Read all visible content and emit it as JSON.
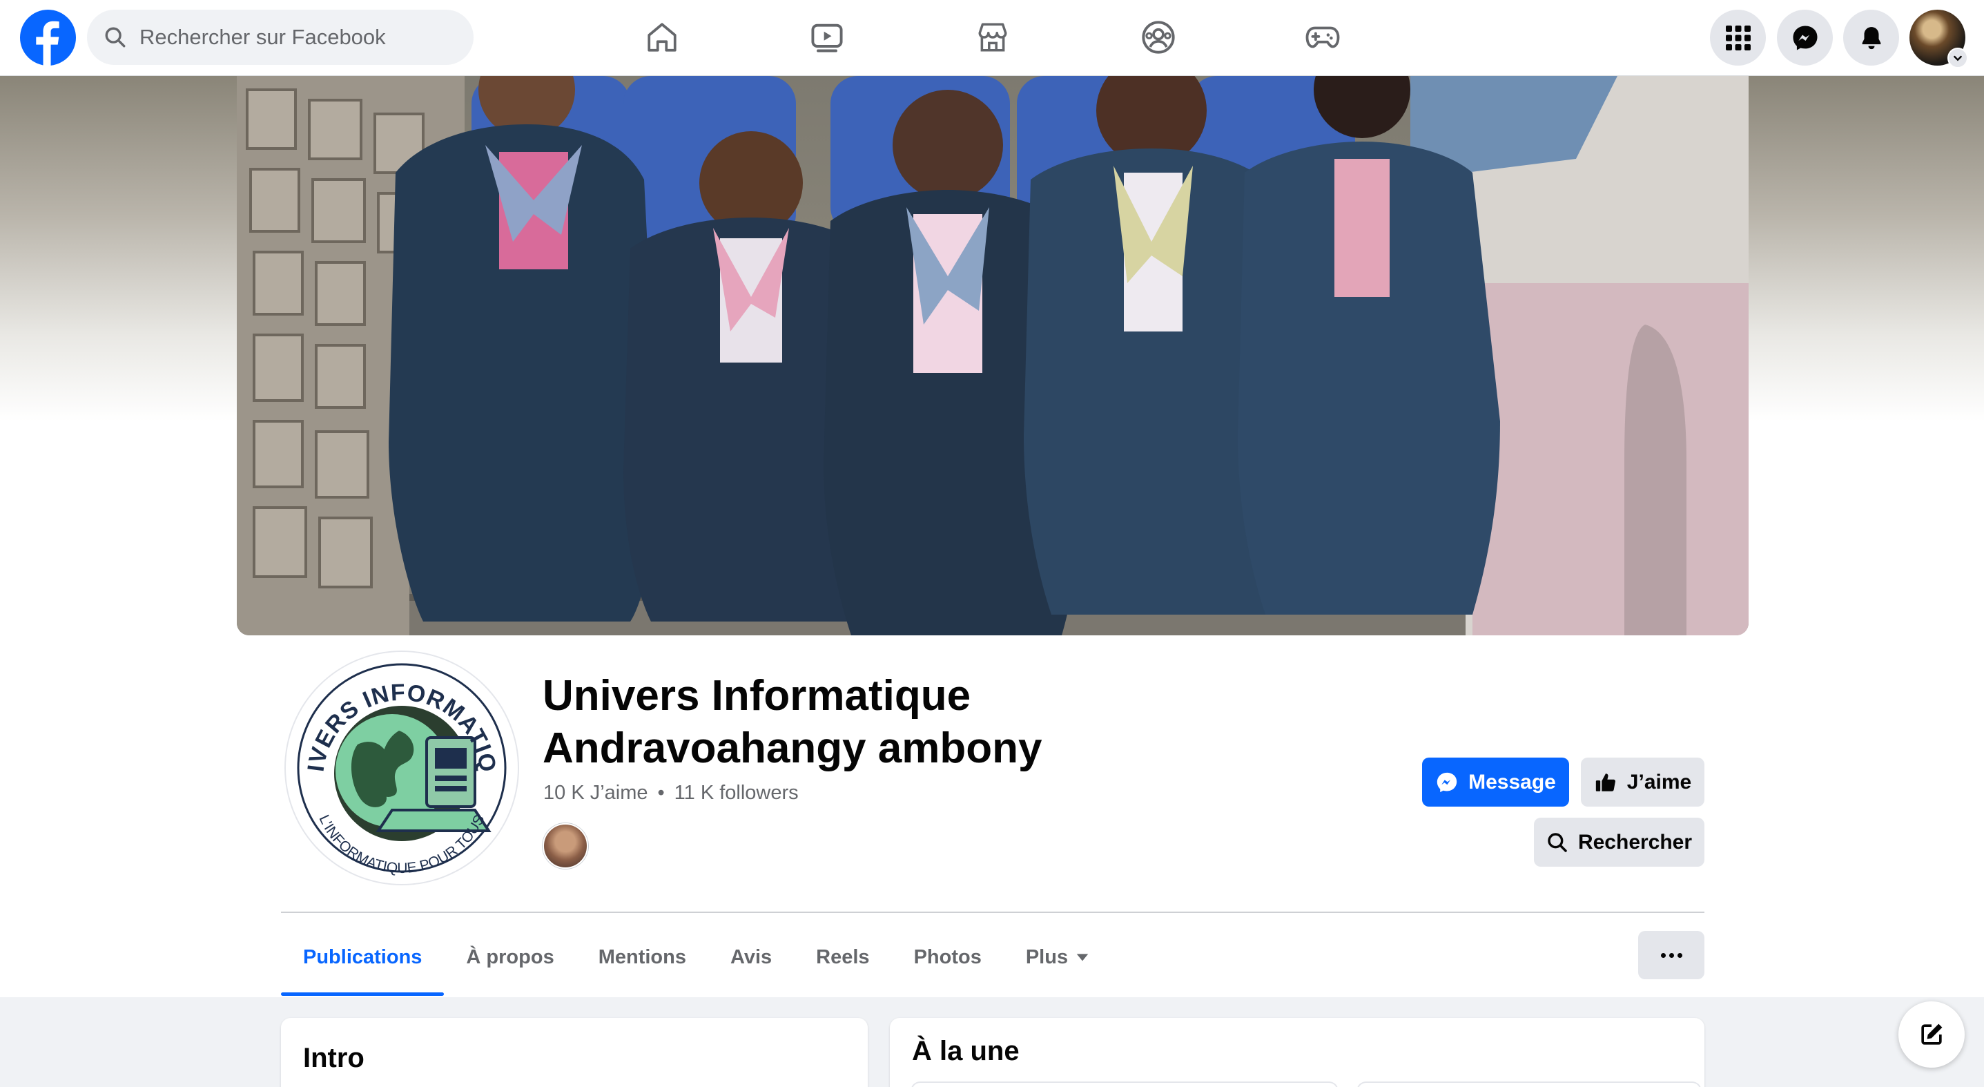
{
  "topbar": {
    "search_placeholder": "Rechercher sur Facebook",
    "nav_icons": [
      "home-icon",
      "video-icon",
      "marketplace-icon",
      "groups-icon",
      "gaming-icon"
    ],
    "right_icons": [
      "apps-grid-icon",
      "messenger-icon",
      "notifications-bell-icon"
    ]
  },
  "colors": {
    "brand_blue": "#0866ff",
    "text_primary": "#050505",
    "text_secondary": "#65676b",
    "button_grey": "#e4e6eb",
    "page_bg": "#f0f2f5"
  },
  "page": {
    "name_line1": "Univers Informatique",
    "name_line2": "Andravoahangy ambony",
    "likes": "10 K J’aime",
    "separator": "•",
    "followers": "11 K followers",
    "logo_text_top": "UNIVERS INFORMATIQUE",
    "logo_text_bottom": "L'INFORMATIQUE POUR TOUS"
  },
  "actions": {
    "message": "Message",
    "like": "J’aime",
    "search": "Rechercher"
  },
  "tabs": [
    {
      "label": "Publications",
      "active": true
    },
    {
      "label": "À propos",
      "active": false
    },
    {
      "label": "Mentions",
      "active": false
    },
    {
      "label": "Avis",
      "active": false
    },
    {
      "label": "Reels",
      "active": false
    },
    {
      "label": "Photos",
      "active": false
    },
    {
      "label": "Plus",
      "active": false
    }
  ],
  "sections": {
    "intro_title": "Intro",
    "featured_title": "À la une"
  }
}
